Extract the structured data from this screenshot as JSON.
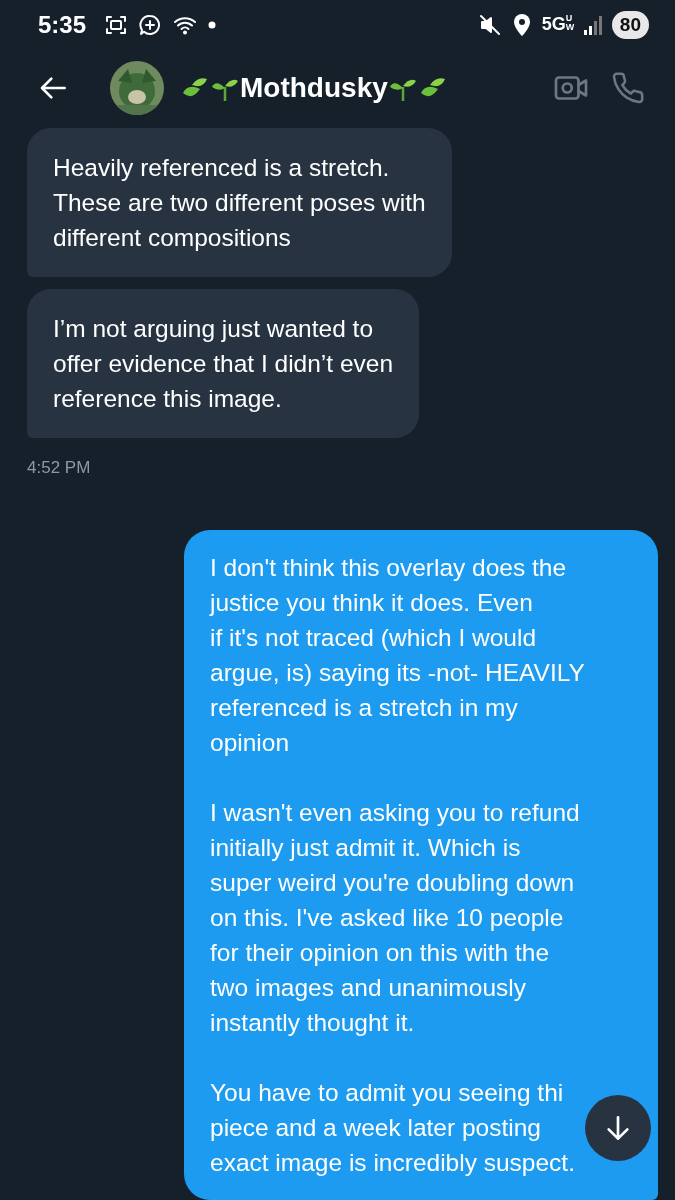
{
  "status_bar": {
    "time": "5:35",
    "network": "5G",
    "network_sup": "UW",
    "battery": "80"
  },
  "header": {
    "name": "Mothdusky"
  },
  "messages": [
    {
      "kind": "received",
      "lines": [
        "Heavily referenced is a stretch.",
        "These are two different poses with",
        "different compositions"
      ]
    },
    {
      "kind": "received",
      "lines": [
        "I’m not arguing just wanted to",
        "offer evidence that I didn’t even",
        "reference this image."
      ]
    },
    {
      "kind": "time",
      "text": "4:52 PM"
    },
    {
      "kind": "sent",
      "paragraphs": [
        [
          "I don't think this overlay does the",
          "justice you think it does. Even",
          "if it's not traced (which I would",
          "argue, is) saying its -not- HEAVILY",
          "referenced is a stretch in my",
          "opinion"
        ],
        [
          "I wasn't even asking you to refund",
          "initially just admit it. Which is",
          "super weird you're doubling down",
          "on this. I've asked like 10 people",
          "for their opinion on this with the",
          "two images and unanimously",
          "instantly thought it."
        ],
        [
          "You have to admit you seeing thi",
          "piece and a week later posting",
          "exact image is incredibly suspect."
        ]
      ]
    }
  ]
}
